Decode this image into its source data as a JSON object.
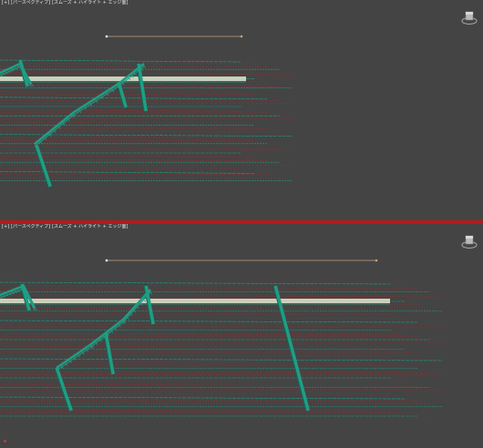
{
  "viewports": {
    "top": {
      "label_parts": [
        "[+]",
        "[パースペクティブ]",
        "[スムーズ + ハイライト + エッジ面]"
      ]
    },
    "bottom": {
      "label_parts": [
        "[+]",
        "[パースペクティブ]",
        "[スムーズ + ハイライト + エッジ面]"
      ]
    }
  },
  "icons": {
    "viewcube": "viewcube-icon",
    "axis": "axis-gizmo-icon"
  },
  "colors": {
    "background": "#444444",
    "active_border": "#b81818",
    "wire_green": "#1f9e84",
    "wire_red": "#8a2e2e",
    "platform": "#dfe8cf",
    "light_line": "#c8a27a"
  }
}
